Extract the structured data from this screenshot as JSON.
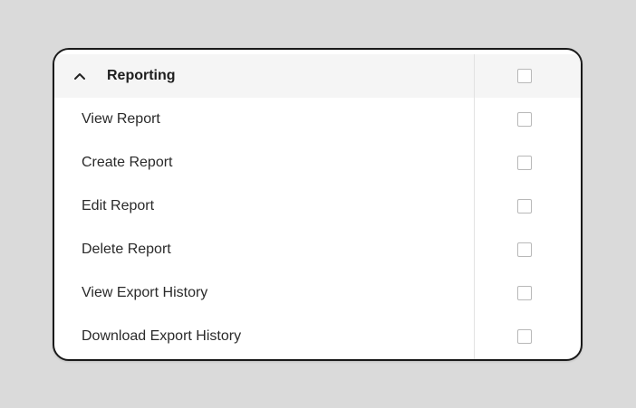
{
  "section": {
    "title": "Reporting",
    "expanded": true,
    "icon": "chevron-up-icon",
    "checked": false
  },
  "permissions": [
    {
      "label": "View Report",
      "checked": false
    },
    {
      "label": "Create Report",
      "checked": false
    },
    {
      "label": "Edit Report",
      "checked": false
    },
    {
      "label": "Delete Report",
      "checked": false
    },
    {
      "label": "View Export History",
      "checked": false
    },
    {
      "label": "Download Export History",
      "checked": false
    }
  ]
}
